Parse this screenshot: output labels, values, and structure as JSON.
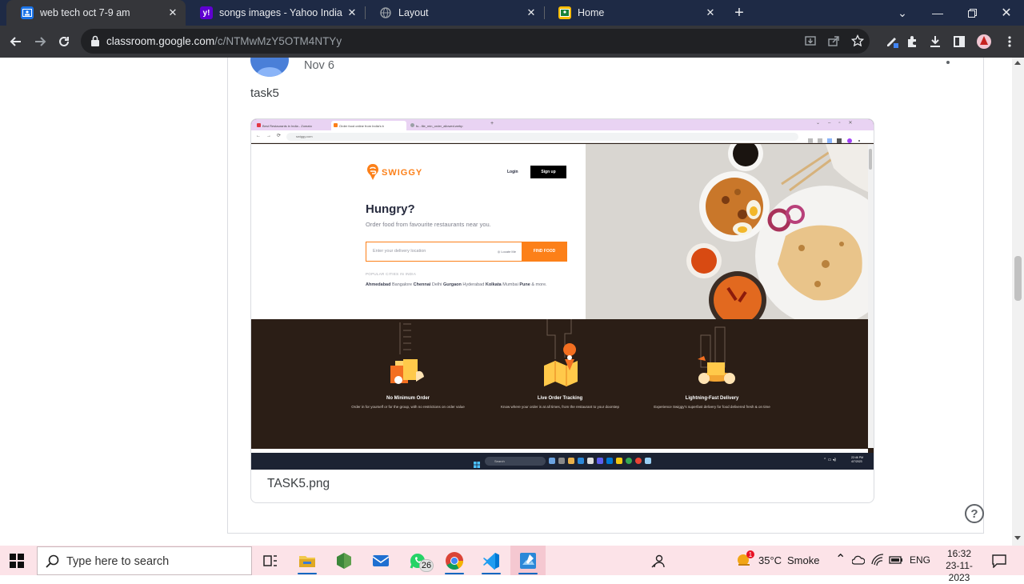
{
  "browser": {
    "tabs": [
      {
        "title": "web tech oct 7-9 am",
        "active": true,
        "icon": "classroom-icon"
      },
      {
        "title": "songs images - Yahoo India Ima",
        "active": false,
        "icon": "yahoo-icon"
      },
      {
        "title": "Layout",
        "active": false,
        "icon": "globe-icon"
      },
      {
        "title": "Home",
        "active": false,
        "icon": "classroom-icon"
      }
    ],
    "url_host": "classroom.google.com",
    "url_path": "/c/NTMwMzY5OTM4NTYy"
  },
  "post": {
    "date": "Nov 6",
    "text": "task5",
    "attachment": {
      "filename": "TASK5.png",
      "screenshot": {
        "tabs": [
          "Best Restaurants in India - Zomato",
          "Order food online from India's b",
          "fu...file_min_order_allowed.webp"
        ],
        "url": "swiggy.com",
        "brand": "SWIGGY",
        "login": "Login",
        "signup": "Sign up",
        "headline": "Hungry?",
        "subheadline": "Order food from favourite restaurants near you.",
        "input_placeholder": "Enter your delivery location",
        "locate_me": "Locate Me",
        "find_food": "FIND FOOD",
        "popular_label": "POPULAR CITIES IN INDIA",
        "cities": [
          {
            "name": "Ahmedabad",
            "bold": true
          },
          {
            "name": "Bangalore",
            "bold": false
          },
          {
            "name": "Chennai",
            "bold": true
          },
          {
            "name": "Delhi",
            "bold": false
          },
          {
            "name": "Gurgaon",
            "bold": true
          },
          {
            "name": "Hyderabad",
            "bold": false
          },
          {
            "name": "Kolkata",
            "bold": true
          },
          {
            "name": "Mumbai",
            "bold": false
          },
          {
            "name": "Pune",
            "bold": true
          },
          {
            "name": "& more.",
            "bold": false
          }
        ],
        "features": [
          {
            "title": "No Minimum Order",
            "desc": "Order in for yourself or for the group, with no restrictions on order value"
          },
          {
            "title": "Live Order Tracking",
            "desc": "Know where your order is at all times, from the restaurant to your doorstep"
          },
          {
            "title": "Lightning-Fast Delivery",
            "desc": "Experience Swiggy's superfast delivery for food delivered fresh & on time"
          }
        ],
        "taskbar_search": "Search",
        "clock_time": "22:46 PM",
        "clock_date": "4/7/2023"
      }
    }
  },
  "taskbar": {
    "search_placeholder": "Type here to search",
    "whatsapp_badge": "26",
    "weather_temp": "35°C",
    "weather_text": "Smoke",
    "language": "ENG",
    "time": "16:32",
    "date": "23-11-2023"
  },
  "colors": {
    "swiggy_orange": "#fc8019",
    "tabbar": "#1e2a45",
    "taskbar": "#fce3e8"
  }
}
